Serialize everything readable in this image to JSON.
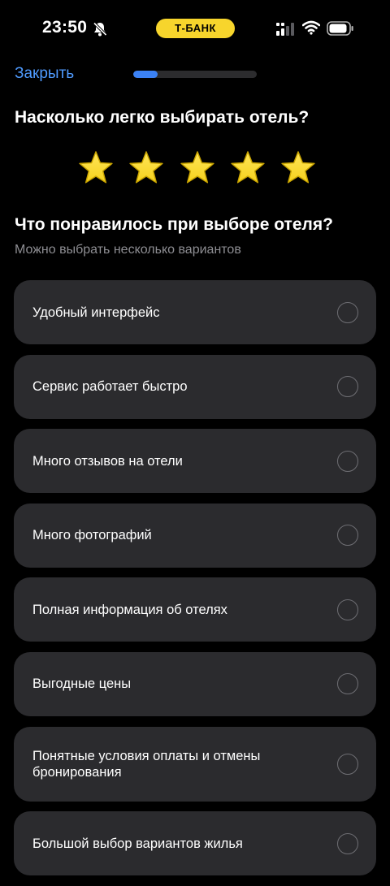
{
  "status_bar": {
    "time": "23:50",
    "bank_label": "Т-БАНК",
    "icons": [
      "bell-slash-icon",
      "signal-icon",
      "wifi-icon",
      "battery-icon"
    ]
  },
  "header": {
    "close_label": "Закрыть",
    "progress_fraction": 0.2
  },
  "question": {
    "title": "Насколько легко выбирать отель?",
    "rating": 5,
    "max_rating": 5,
    "star_color": "#f5d11c"
  },
  "section": {
    "title": "Что понравилось при выборе отеля?",
    "subtitle": "Можно выбрать несколько вариантов"
  },
  "options": [
    {
      "label": "Удобный интерфейс",
      "selected": false
    },
    {
      "label": "Сервис работает быстро",
      "selected": false
    },
    {
      "label": "Много отзывов на отели",
      "selected": false
    },
    {
      "label": "Много фотографий",
      "selected": false
    },
    {
      "label": "Полная информация об отелях",
      "selected": false
    },
    {
      "label": "Выгодные цены",
      "selected": false
    },
    {
      "label": "Понятные условия оплаты и отмены бронирования",
      "selected": false
    },
    {
      "label": "Большой выбор вариантов жилья",
      "selected": false
    }
  ],
  "colors": {
    "background": "#000000",
    "card": "#2b2b2e",
    "accent_link": "#4f9bff",
    "progress": "#3b82f6",
    "bank_yellow": "#f7d52c"
  }
}
